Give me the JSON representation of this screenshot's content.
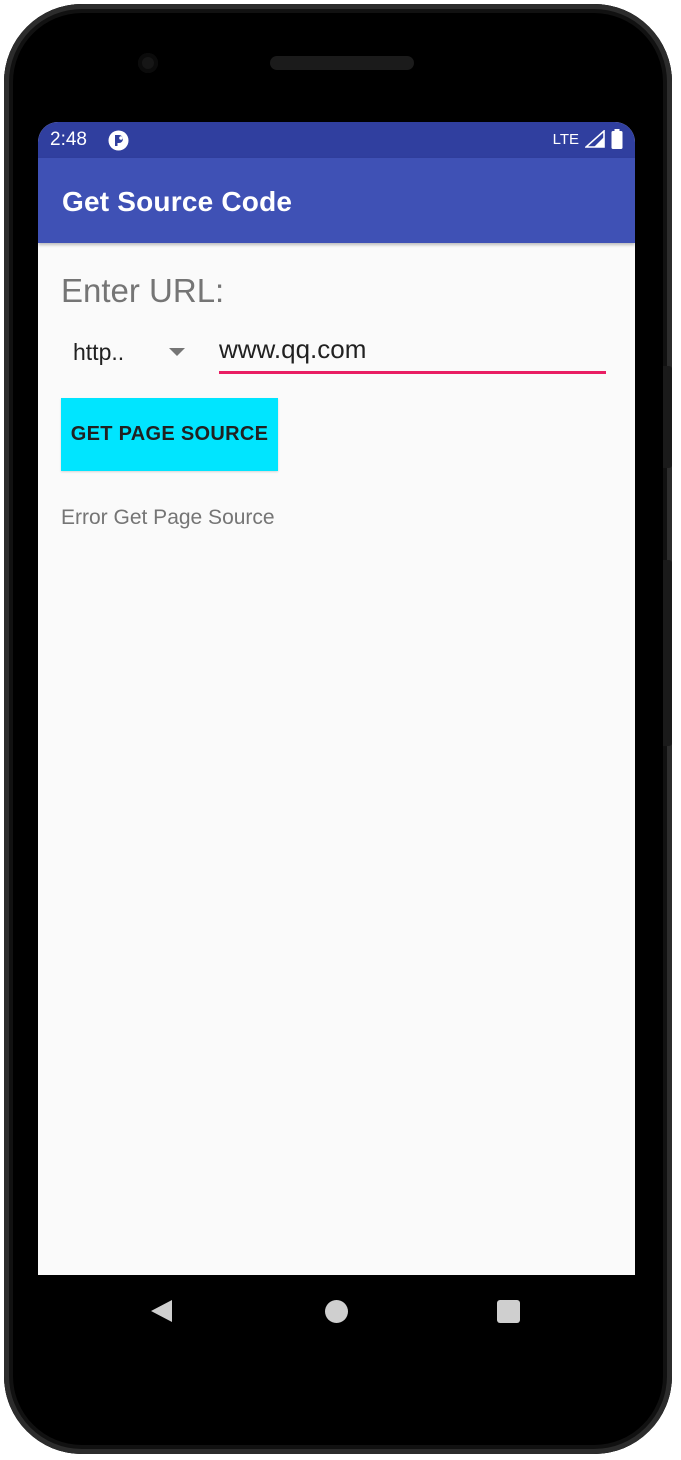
{
  "status_bar": {
    "time": "2:48",
    "app_icon": "app-notification-icon",
    "network_label": "LTE",
    "signal_icon": "signal-icon",
    "battery_icon": "battery-icon"
  },
  "app_bar": {
    "title": "Get Source Code"
  },
  "form": {
    "label": "Enter URL:",
    "protocol_selected": "http..",
    "url_value": "www.qq.com",
    "button_label": "GET PAGE SOURCE"
  },
  "result": {
    "text": "Error Get Page Source"
  },
  "nav_bar": {
    "back_icon": "back-triangle-icon",
    "home_icon": "home-circle-icon",
    "recents_icon": "recents-square-icon"
  },
  "colors": {
    "status_bar": "#303f9f",
    "app_bar": "#3f51b5",
    "accent": "#e91e63",
    "button": "#00e5ff"
  }
}
